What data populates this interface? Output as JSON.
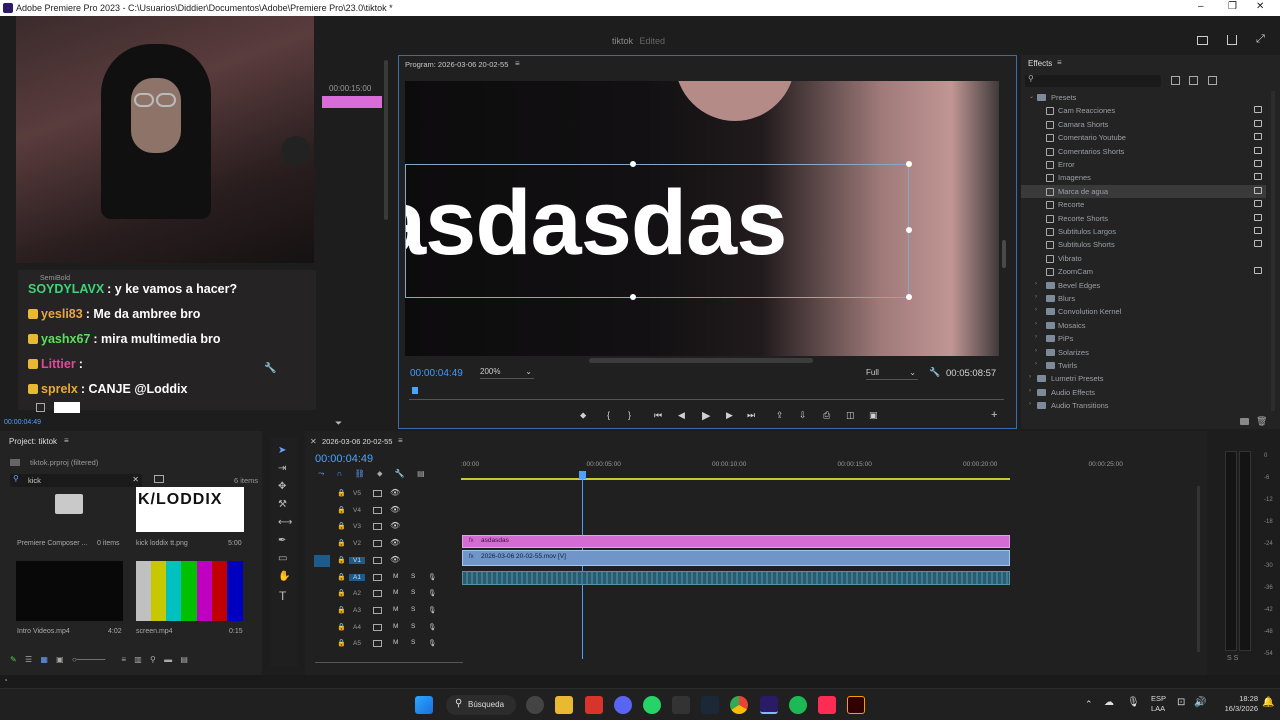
{
  "window": {
    "title": "Adobe Premiere Pro 2023 - C:\\Usuarios\\Diddier\\Documentos\\Adobe\\Premiere Pro\\23.0\\tiktok *",
    "project_name": "tiktok",
    "edit_status": "Edited"
  },
  "program": {
    "title": "Program: 2026-03-06 20-02-55",
    "overlay_text": "asdasdas",
    "timecode": "00:00:04:49",
    "zoom": "200%",
    "quality": "Full",
    "duration": "00:05:08:57"
  },
  "source": {
    "timecode_top": "00:00:15:00",
    "timecode_bottom": "00:00:04:49"
  },
  "effects": {
    "title": "Effects",
    "search_placeholder": "",
    "items": [
      {
        "label": "Presets",
        "level": 0,
        "lock": false,
        "expanded": true
      },
      {
        "label": "Cam Reacciones",
        "level": 1,
        "lock": true
      },
      {
        "label": "Camara Shorts",
        "level": 1,
        "lock": true
      },
      {
        "label": "Comentario Youtube",
        "level": 1,
        "lock": true
      },
      {
        "label": "Comentarios Shorts",
        "level": 1,
        "lock": true
      },
      {
        "label": "Error",
        "level": 1,
        "lock": true
      },
      {
        "label": "Imagenes",
        "level": 1,
        "lock": true
      },
      {
        "label": "Marca de agua",
        "level": 1,
        "lock": true,
        "selected": true
      },
      {
        "label": "Recorte",
        "level": 1,
        "lock": true
      },
      {
        "label": "Recorte Shorts",
        "level": 1,
        "lock": true
      },
      {
        "label": "Subtitulos Largos",
        "level": 1,
        "lock": true
      },
      {
        "label": "Subtitulos Shorts",
        "level": 1,
        "lock": true
      },
      {
        "label": "Vibrato",
        "level": 1,
        "lock": false
      },
      {
        "label": "ZoomCam",
        "level": 1,
        "lock": true
      },
      {
        "label": "Bevel Edges",
        "level": 1,
        "lock": false,
        "collapsed": true
      },
      {
        "label": "Blurs",
        "level": 1,
        "lock": false,
        "collapsed": true
      },
      {
        "label": "Convolution Kernel",
        "level": 1,
        "lock": false,
        "collapsed": true
      },
      {
        "label": "Mosaics",
        "level": 1,
        "lock": false,
        "collapsed": true
      },
      {
        "label": "PiPs",
        "level": 1,
        "lock": false,
        "collapsed": true
      },
      {
        "label": "Solarizes",
        "level": 1,
        "lock": false,
        "collapsed": true
      },
      {
        "label": "Twirls",
        "level": 1,
        "lock": false,
        "collapsed": true
      },
      {
        "label": "Lumetri Presets",
        "level": 0,
        "lock": false,
        "collapsed": true
      },
      {
        "label": "Audio Effects",
        "level": 0,
        "lock": false,
        "collapsed": true
      },
      {
        "label": "Audio Transitions",
        "level": 0,
        "lock": false,
        "collapsed": true
      }
    ]
  },
  "chat": {
    "font_hint": "SemiBold",
    "lines": [
      {
        "user": "SOYDYLAVX",
        "msg": ": y ke vamos a hacer?",
        "color": "#3fd37a"
      },
      {
        "user": "yesli83",
        "msg": ": Me da ambree bro",
        "color": "#e8a93a"
      },
      {
        "user": "yashx67",
        "msg": ": mira multimedia bro",
        "color": "#5be05b"
      },
      {
        "user": "Littier",
        "msg": ":",
        "color": "#e04a9a"
      },
      {
        "user": "sprelx",
        "msg": ": CANJE @Loddix",
        "color": "#e8a93a"
      }
    ]
  },
  "project": {
    "title": "Project: tiktok",
    "file": "tiktok.prproj (filtered)",
    "search": "kick",
    "count": "6 items",
    "bins": [
      {
        "name": "Premiere Composer ...",
        "meta": "0 items"
      },
      {
        "name": "kick loddix tt.png",
        "meta": "5:00",
        "logo": "K/LODDIX"
      },
      {
        "name": "Intro Videos.mp4",
        "meta": "4:02"
      },
      {
        "name": "screen.mp4",
        "meta": "0:15"
      }
    ]
  },
  "timeline": {
    "sequence": "2026-03-06 20-02-55",
    "timecode": "00:00:04:49",
    "ruler": [
      ":00:00",
      "00:00:05:00",
      "00:00:10:00",
      "00:00:15:00",
      "00:00:20:00",
      "00:00:25:00"
    ],
    "video_tracks": [
      "V5",
      "V4",
      "V3",
      "V2",
      "V1"
    ],
    "audio_tracks": [
      "A1",
      "A2",
      "A3",
      "A4",
      "A5"
    ],
    "clips": {
      "text": "asdasdas",
      "video": "2026-03-06 20-02-55.mov [V]"
    }
  },
  "meter": {
    "labels": [
      "0",
      "-6",
      "-12",
      "-18",
      "-24",
      "-30",
      "-36",
      "-42",
      "-48",
      "-54"
    ],
    "bottom": "S  S"
  },
  "taskbar": {
    "search": "Búsqueda",
    "lang": "ESP\nLAA",
    "lang1": "ESP",
    "lang2": "LAA",
    "time": "18:28",
    "date": "16/3/2026"
  }
}
